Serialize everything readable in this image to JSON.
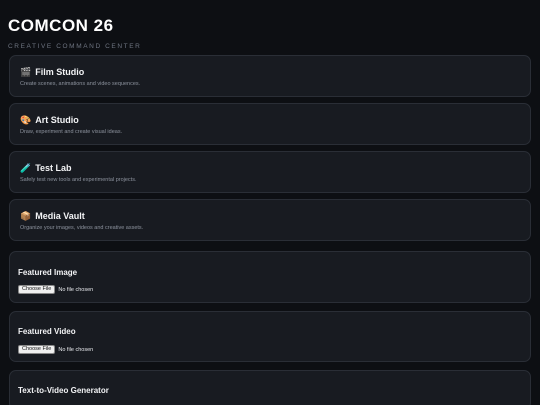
{
  "header": {
    "title": "COMCON 26",
    "subtitle": "CREATIVE COMMAND CENTER"
  },
  "nav_cards": [
    {
      "icon": "🎬",
      "icon_name": "clapperboard-icon",
      "title": "Film Studio",
      "description": "Create scenes, animations and video sequences."
    },
    {
      "icon": "🎨",
      "icon_name": "palette-icon",
      "title": "Art Studio",
      "description": "Draw, experiment and create visual ideas."
    },
    {
      "icon": "🧪",
      "icon_name": "test-tube-icon",
      "title": "Test Lab",
      "description": "Safely test new tools and experimental projects."
    },
    {
      "icon": "📦",
      "icon_name": "package-icon",
      "title": "Media Vault",
      "description": "Organize your images, videos and creative assets."
    }
  ],
  "featured_image": {
    "title": "Featured Image",
    "button_label": "Choose File",
    "status": "No file chosen"
  },
  "featured_video": {
    "title": "Featured Video",
    "button_label": "Choose File",
    "status": "No file chosen"
  },
  "text_to_video": {
    "title": "Text-to-Video Generator"
  },
  "colors": {
    "background": "#0d0f13",
    "card": "#181b21",
    "card_border": "#2a2e36"
  }
}
